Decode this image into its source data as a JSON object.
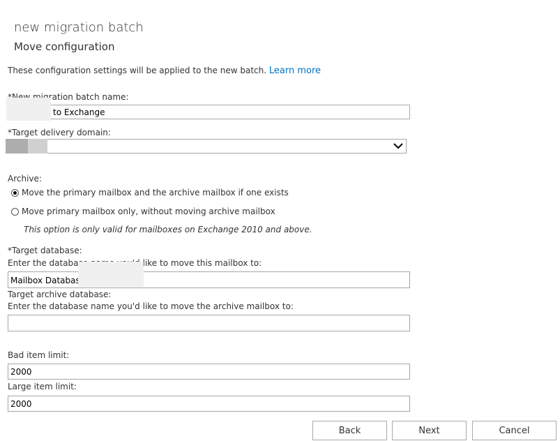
{
  "header": {
    "title": "new migration batch",
    "subtitle": "Move configuration"
  },
  "intro": {
    "text": "These configuration settings will be applied to the new batch.",
    "link": "Learn more"
  },
  "batch_name": {
    "label": "*New migration batch name:",
    "value": "to Exchange"
  },
  "delivery_domain": {
    "label": "*Target delivery domain:",
    "value": ""
  },
  "archive": {
    "label": "Archive:",
    "options": [
      {
        "label": "Move the primary mailbox and the archive mailbox if one exists",
        "selected": true
      },
      {
        "label": "Move primary mailbox only, without moving archive mailbox",
        "selected": false
      }
    ],
    "note": "This option is only valid for mailboxes on Exchange 2010 and above."
  },
  "target_db": {
    "label": "*Target database:",
    "hint": "Enter the database name you'd like to move this mailbox to:",
    "value": "Mailbox Databas"
  },
  "archive_db": {
    "label": "Target archive database:",
    "hint": "Enter the database name you'd like to move the archive mailbox to:",
    "value": ""
  },
  "bad_item": {
    "label": "Bad item limit:",
    "value": "2000"
  },
  "large_item": {
    "label": "Large item limit:",
    "value": "2000"
  },
  "buttons": {
    "back": "Back",
    "next": "Next",
    "cancel": "Cancel"
  },
  "icons": {
    "dropdown": "chevron-down-icon"
  }
}
